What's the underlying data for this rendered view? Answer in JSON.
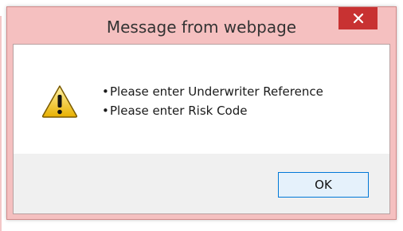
{
  "dialog": {
    "title": "Message from webpage",
    "close_icon": "close-icon",
    "warning_icon": "warning-triangle-icon",
    "messages": [
      "Please enter Underwriter Reference",
      "Please enter Risk Code"
    ],
    "ok_label": "OK"
  },
  "colors": {
    "frame": "#f5c0c0",
    "close_button": "#c83232",
    "button_area": "#f0f0f0",
    "ok_border": "#0078d7"
  }
}
